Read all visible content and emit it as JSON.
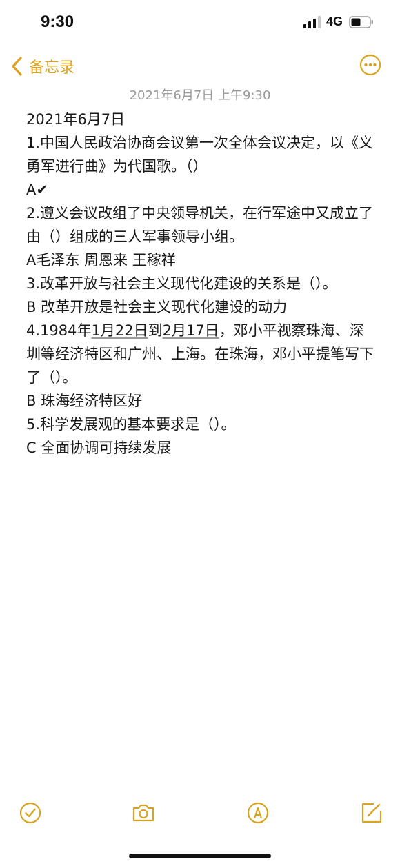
{
  "status_bar": {
    "time": "9:30",
    "network": "4G",
    "signal_icon": "cellular-signal-icon",
    "battery_icon": "battery-icon"
  },
  "nav": {
    "back_label": "备忘录",
    "back_icon": "chevron-left-icon",
    "more_icon": "ellipsis-circle-icon"
  },
  "note": {
    "date_header": "2021年6月7日 上午9:30",
    "lines": {
      "l1": "2021年6月7日",
      "l2": "1.中国人民政治协商会议第一次全体会议决定，以《义勇军进行曲》为代国歌。（）",
      "l3": "A✔",
      "l4": "2.遵义会议改组了中央领导机关，在行军途中又成立了由（）组成的三人军事领导小组。",
      "l5": "A毛泽东 周恩来 王稼祥",
      "l6": "3.改革开放与社会主义现代化建设的关系是（）。",
      "l7": "B 改革开放是社会主义现代化建设的动力",
      "l8_a": "4.1984年",
      "l8_b": "1月22日",
      "l8_c": "到",
      "l8_d": "2月17日",
      "l8_e": "，邓小平视察珠海、深圳等经济特区和广州、上海。在珠海，邓小平提笔写下了（）。",
      "l9": "B 珠海经济特区好",
      "l10": "5.科学发展观的基本要求是（）。",
      "l11": "C 全面协调可持续发展"
    }
  },
  "toolbar": {
    "checklist_icon": "checklist-icon",
    "camera_icon": "camera-icon",
    "markup_icon": "markup-pen-icon",
    "compose_icon": "compose-icon"
  },
  "colors": {
    "accent": "#d9a321",
    "text": "#1a1a1a",
    "muted": "#9a9a9a"
  }
}
